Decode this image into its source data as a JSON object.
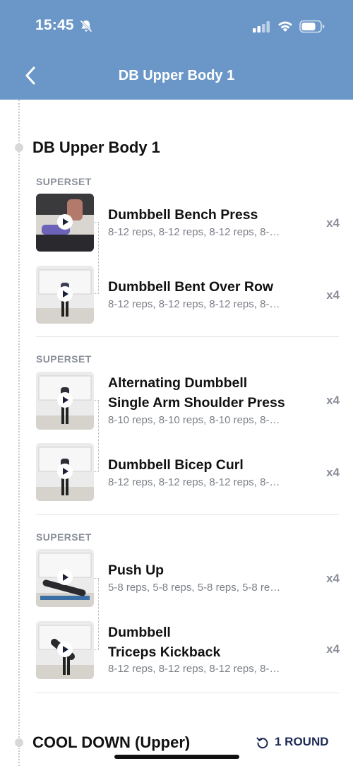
{
  "status_bar": {
    "time": "15:45"
  },
  "header": {
    "title": "DB Upper Body 1"
  },
  "workout": {
    "title": "DB Upper Body 1",
    "groups": [
      {
        "label": "SUPERSET",
        "exercises": [
          {
            "name": "Dumbbell Bench Press",
            "reps": "8-12 reps, 8-12 reps, 8-12 reps, 8-…",
            "sets": "x4"
          },
          {
            "name": "Dumbbell Bent Over Row",
            "reps": "8-12 reps, 8-12 reps, 8-12 reps, 8-…",
            "sets": "x4"
          }
        ]
      },
      {
        "label": "SUPERSET",
        "exercises": [
          {
            "name_line1": "Alternating Dumbbell",
            "name_line2": "Single Arm Shoulder Press",
            "reps": "8-10 reps, 8-10 reps, 8-10 reps, 8-…",
            "sets": "x4"
          },
          {
            "name": "Dumbbell Bicep Curl",
            "reps": "8-12 reps, 8-12 reps, 8-12 reps, 8-…",
            "sets": "x4"
          }
        ]
      },
      {
        "label": "SUPERSET",
        "exercises": [
          {
            "name": "Push Up",
            "reps": "5-8 reps, 5-8 reps, 5-8 reps, 5-8 re…",
            "sets": "x4"
          },
          {
            "name_line1": "Dumbbell",
            "name_line2": "Triceps Kickback",
            "reps": "8-12 reps, 8-12 reps, 8-12 reps, 8-…",
            "sets": "x4"
          }
        ]
      }
    ]
  },
  "cool_down": {
    "title": "COOL DOWN (Upper)",
    "rounds": "1 ROUND"
  },
  "colors": {
    "header_bg": "#6b97c8",
    "accent_dark": "#1d2a55",
    "muted": "#8a8f9a"
  },
  "icons": [
    "bell-off-icon",
    "signal-icon",
    "wifi-icon",
    "battery-icon",
    "back-chevron-icon",
    "play-icon",
    "repeat-icon"
  ]
}
